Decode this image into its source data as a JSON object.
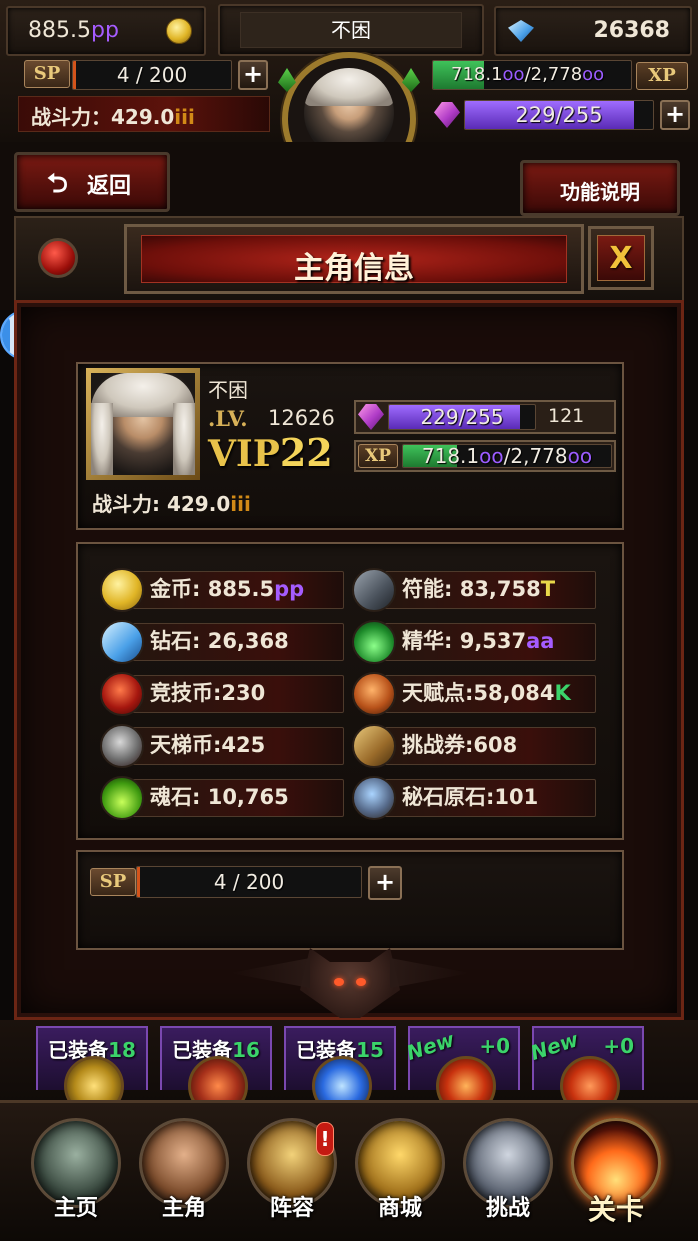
{
  "top": {
    "gold_value": "885.5",
    "gold_suffix": "pp",
    "player_name": "不困",
    "diamond_value": "26368",
    "sp_tag": "SP",
    "sp_value": "4 / 200",
    "power_label": "战斗力：",
    "power_value": "429.0",
    "power_suffix": "iii",
    "xp_prefix": "718.1",
    "xp_suffix_1": "oo",
    "xp_mid": "/2,778",
    "xp_suffix_2": "oo",
    "xp_tag": "XP",
    "stamina": "229/255",
    "xp_fill_percent": 26,
    "stamina_fill_percent": 90
  },
  "buttons": {
    "back": "返回",
    "help": "功能说明",
    "close": "X"
  },
  "panel_title": "主角信息",
  "profile": {
    "name": "不困",
    "lv_label": ".LV.",
    "lv_value": "12626",
    "vip_text": "VIP",
    "vip_level": "22",
    "stamina": "229/255",
    "stamina_extra": "121",
    "xp_tag": "XP",
    "xp_prefix": "718.1",
    "xp_suffix_1": "oo",
    "xp_mid": "/2,778",
    "xp_suffix_2": "oo",
    "power_label": "战斗力:",
    "power_value": "429.0",
    "power_suffix": "iii"
  },
  "resources": [
    {
      "icon": "gold-coin-icon",
      "label": "金币: 885.5",
      "suffix": "pp",
      "suffix_color": "#a55cff"
    },
    {
      "icon": "rune-icon",
      "label": "符能: 83,758",
      "suffix": "T",
      "suffix_color": "#e9d84a"
    },
    {
      "icon": "diamond-icon",
      "label": "钻石: 26,368",
      "suffix": "",
      "suffix_color": ""
    },
    {
      "icon": "essence-icon",
      "label": "精华: 9,537",
      "suffix": "aa",
      "suffix_color": "#a55cff"
    },
    {
      "icon": "arena-coin-icon",
      "label": "竞技币:230",
      "suffix": "",
      "suffix_color": ""
    },
    {
      "icon": "talent-icon",
      "label": "天赋点:58,084",
      "suffix": "K",
      "suffix_color": "#3bd36a"
    },
    {
      "icon": "ladder-coin-icon",
      "label": "天梯币:425",
      "suffix": "",
      "suffix_color": ""
    },
    {
      "icon": "challenge-ticket-icon",
      "label": "挑战券:608",
      "suffix": "",
      "suffix_color": ""
    },
    {
      "icon": "soul-stone-icon",
      "label": "魂石: 10,765",
      "suffix": "",
      "suffix_color": ""
    },
    {
      "icon": "secret-ore-icon",
      "label": "秘石原石:101",
      "suffix": "",
      "suffix_color": ""
    }
  ],
  "sp_section": {
    "tag": "SP",
    "value": "4 / 200"
  },
  "equipment": [
    {
      "label": "已装备",
      "count": "18",
      "new": ""
    },
    {
      "label": "已装备",
      "count": "16",
      "new": ""
    },
    {
      "label": "已装备",
      "count": "15",
      "new": ""
    },
    {
      "label": "",
      "count": "+0",
      "new": "New"
    },
    {
      "label": "",
      "count": "+0",
      "new": "New"
    }
  ],
  "nav": [
    {
      "label": "主页",
      "icon": "castle-icon"
    },
    {
      "label": "主角",
      "icon": "hero-icon"
    },
    {
      "label": "阵容",
      "icon": "lineup-icon",
      "alert": "!"
    },
    {
      "label": "商城",
      "icon": "treasure-chest-icon"
    },
    {
      "label": "挑战",
      "icon": "crossed-axes-icon"
    },
    {
      "label": "关卡",
      "icon": "stage-fire-icon"
    }
  ],
  "colors": {
    "gold_accent": "#e0b526",
    "title_red": "#8f1a12",
    "purple": "#a55cff",
    "green_xp": "#2fa24a"
  }
}
